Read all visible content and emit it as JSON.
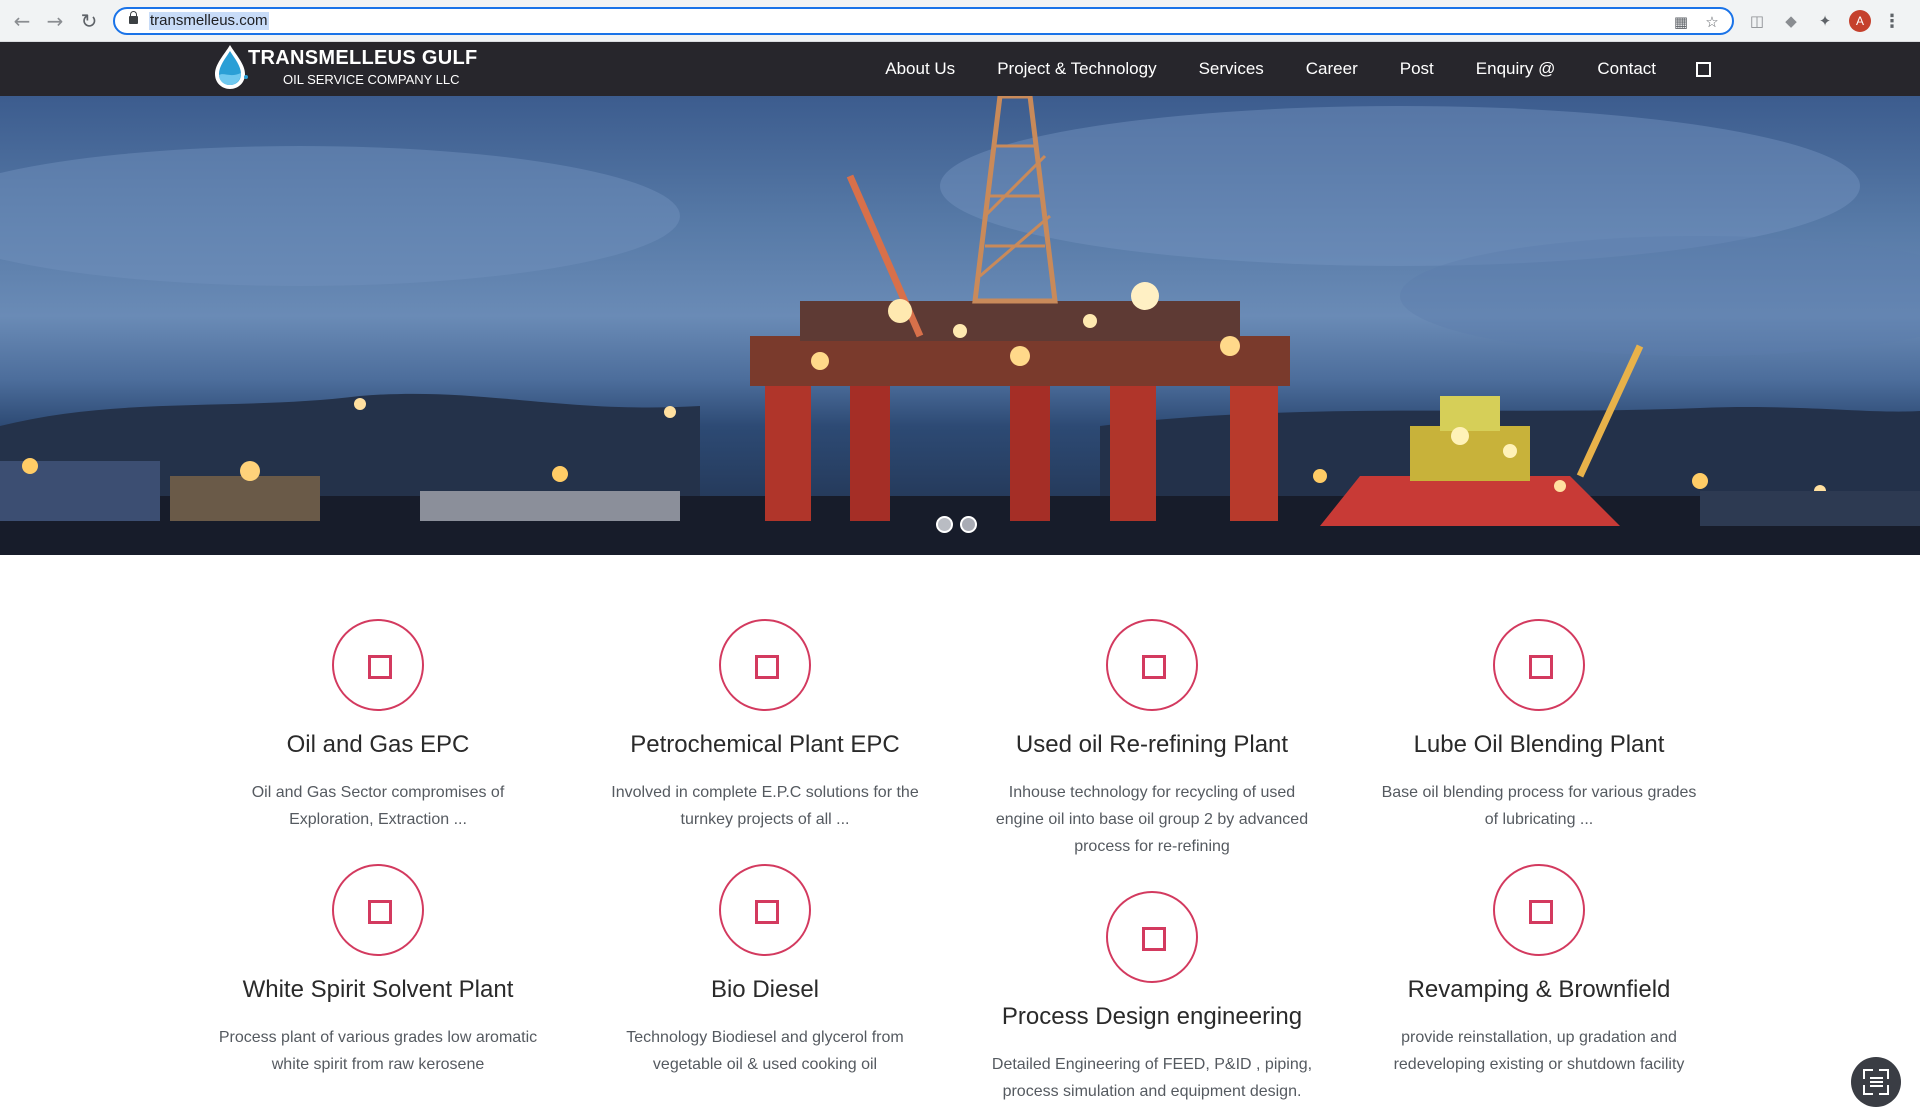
{
  "browser": {
    "url": "transmelleus.com",
    "profile_initial": "A",
    "icons": [
      "back-arrow-icon",
      "forward-arrow-icon",
      "reload-icon",
      "lock-icon",
      "qr-code-icon",
      "bookmark-star-icon",
      "code-extension-icon",
      "shield-extension-icon",
      "puzzle-extensions-icon",
      "kebab-menu-icon"
    ]
  },
  "header": {
    "brand_name": "TRANSMELLEUS GULF",
    "brand_tagline": "OIL SERVICE COMPANY LLC",
    "nav": [
      {
        "label": "About Us"
      },
      {
        "label": "Project & Technology"
      },
      {
        "label": "Services"
      },
      {
        "label": "Career"
      },
      {
        "label": "Post"
      },
      {
        "label": "Enquiry @"
      },
      {
        "label": "Contact"
      }
    ],
    "colors": {
      "background": "#27262c",
      "text": "#ffffff"
    }
  },
  "hero": {
    "slide_count": 2,
    "active_slide": 1
  },
  "services": [
    {
      "title": "Oil and Gas EPC",
      "desc_lines": [
        "Oil and Gas Sector compromises of",
        "Exploration, Extraction ..."
      ]
    },
    {
      "title": "Petrochemical Plant EPC",
      "desc_lines": [
        "Involved in complete E.P.C solutions for the",
        "turnkey projects of all ..."
      ]
    },
    {
      "title": "Used oil Re-refining Plant",
      "desc_lines": [
        "Inhouse technology for recycling of used",
        "engine oil into base oil group 2 by advanced",
        "process for re-refining"
      ]
    },
    {
      "title": "Lube Oil Blending Plant",
      "desc_lines": [
        "Base oil blending process for various grades",
        "of lubricating ..."
      ]
    },
    {
      "title": "White Spirit Solvent Plant",
      "desc_lines": [
        "Process plant of various grades low aromatic",
        "white spirit from raw kerosene"
      ]
    },
    {
      "title": "Bio Diesel",
      "desc_lines": [
        "Technology Biodiesel and glycerol from",
        "vegetable oil & used cooking oil"
      ]
    },
    {
      "title": "Process Design engineering",
      "desc_lines": [
        "Detailed Engineering of FEED, P&ID , piping,",
        "process simulation and equipment design."
      ]
    },
    {
      "title": "Revamping & Brownfield",
      "desc_lines": [
        "provide reinstallation, up gradation and",
        "redeveloping existing or shutdown facility"
      ]
    }
  ],
  "accent_color": "#d33a5f"
}
